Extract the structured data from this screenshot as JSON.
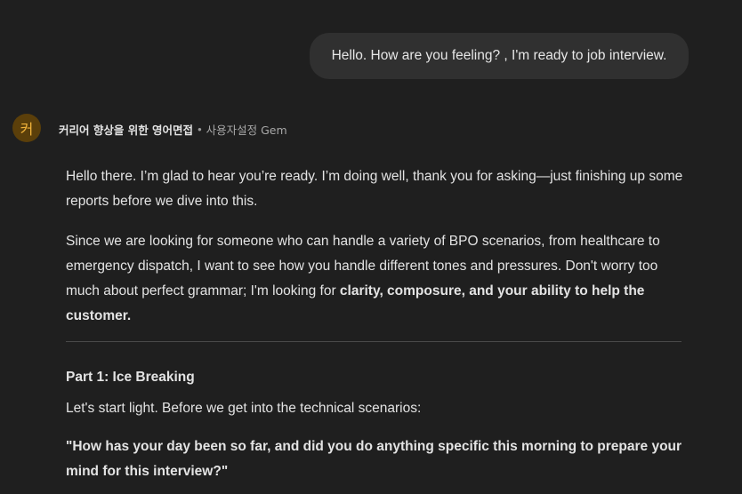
{
  "user_message": "Hello. How are you feeling? , I'm ready to job interview.",
  "gem": {
    "avatar_letter": "커",
    "name": "커리어 향상을 위한 영어면접",
    "separator": "•",
    "type": "사용자설정 Gem"
  },
  "response": {
    "p1": "Hello there. I’m glad to hear you’re ready. I’m doing well, thank you for asking—just finishing up some reports before we dive into this.",
    "p2_lead": "Since we are looking for someone who can handle a variety of BPO scenarios, from healthcare to emergency dispatch, I want to see how you handle different tones and pressures. Don't worry too much about perfect grammar; I'm looking for ",
    "p2_bold": "clarity, composure, and your ability to help the customer.",
    "part_title": "Part 1: Ice Breaking",
    "p3": "Let's start light. Before we get into the technical scenarios:",
    "question": "\"How has your day been so far, and did you do anything specific this morning to prepare your mind for this interview?\""
  }
}
